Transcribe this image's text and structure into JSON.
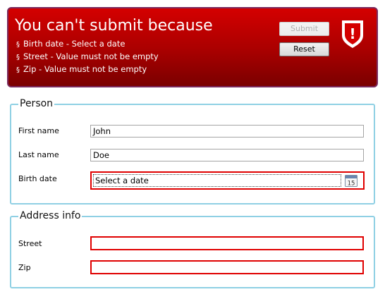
{
  "banner": {
    "title": "You can't submit because",
    "errors": [
      {
        "field": "Birth date",
        "message": "Select a date"
      },
      {
        "field": "Street",
        "message": "Value must not be empty"
      },
      {
        "field": "Zip",
        "message": "Value must not be empty"
      }
    ],
    "bullet": "§",
    "submit_label": "Submit",
    "reset_label": "Reset",
    "icon": "error-shield-icon",
    "icon_glyph": "!"
  },
  "person": {
    "legend": "Person",
    "first_name": {
      "label": "First name",
      "value": "John"
    },
    "last_name": {
      "label": "Last name",
      "value": "Doe"
    },
    "birth_date": {
      "label": "Birth date",
      "placeholder": "Select a date",
      "calendar_day": "15"
    }
  },
  "address": {
    "legend": "Address info",
    "street": {
      "label": "Street",
      "value": ""
    },
    "zip": {
      "label": "Zip",
      "value": ""
    }
  },
  "colors": {
    "error": "#e00000",
    "banner_top": "#d40000",
    "banner_bottom": "#7a0000",
    "group_border": "#8fd0e4"
  }
}
